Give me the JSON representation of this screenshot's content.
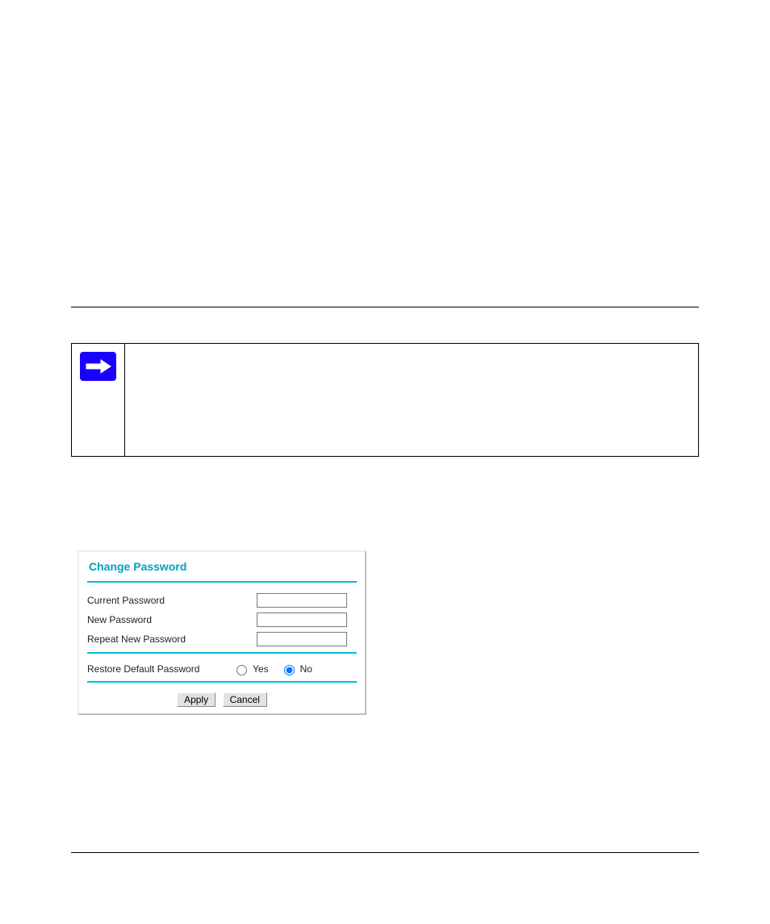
{
  "dialog": {
    "title": "Change Password",
    "fields": {
      "current_label": "Current Password",
      "current_value": "",
      "new_label": "New Password",
      "new_value": "",
      "repeat_label": "Repeat New Password",
      "repeat_value": ""
    },
    "restore": {
      "label": "Restore Default Password",
      "yes_label": "Yes",
      "no_label": "No",
      "selected": "no"
    },
    "buttons": {
      "apply": "Apply",
      "cancel": "Cancel"
    }
  },
  "note_icon": "arrow-right-icon"
}
